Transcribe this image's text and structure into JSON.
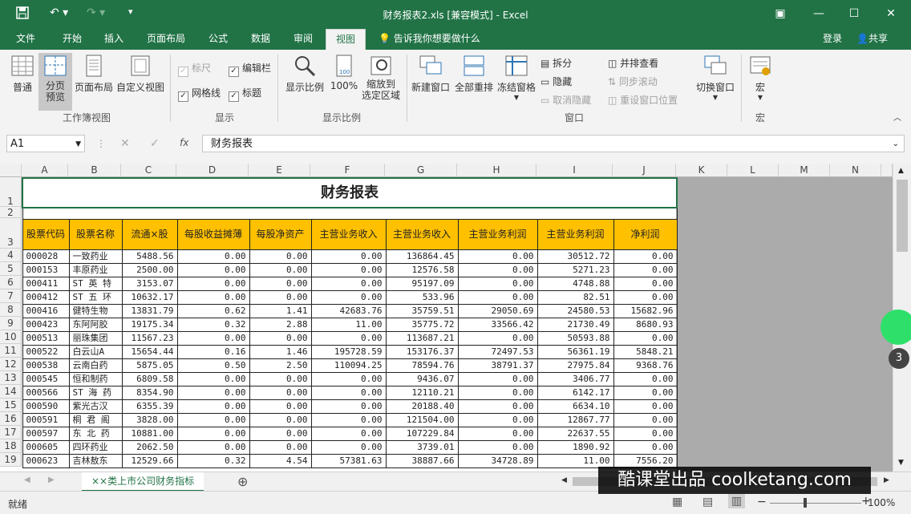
{
  "window": {
    "title": "财务报表2.xls  [兼容模式] - Excel",
    "account": "登录",
    "share": "共享",
    "tell_me": "告诉我你想要做什么"
  },
  "tabs": [
    "文件",
    "开始",
    "插入",
    "页面布局",
    "公式",
    "数据",
    "审阅",
    "视图"
  ],
  "ribbon": {
    "workbook_views": {
      "label": "工作簿视图",
      "normal": "普通",
      "page_break": "分页\n预览",
      "page_layout": "页面布局",
      "custom_views": "自定义视图"
    },
    "show": {
      "label": "显示",
      "ruler": "标尺",
      "gridlines": "网格线",
      "formula_bar": "编辑栏",
      "headings": "标题"
    },
    "zoom": {
      "label": "显示比例",
      "zoom": "显示比例",
      "hundred": "100%",
      "zoom_sel_1": "缩放到",
      "zoom_sel_2": "选定区域"
    },
    "window": {
      "label": "窗口",
      "new_window": "新建窗口",
      "arrange_all": "全部重排",
      "freeze": "冻结窗格",
      "split": "拆分",
      "hide": "隐藏",
      "unhide": "取消隐藏",
      "side_by_side": "并排查看",
      "sync_scroll": "同步滚动",
      "reset_pos": "重设窗口位置",
      "switch": "切换窗口"
    },
    "macros": {
      "label": "宏",
      "macros": "宏"
    }
  },
  "formula_bar": {
    "name_box": "A1",
    "content": "财务报表"
  },
  "columns": [
    "A",
    "B",
    "C",
    "D",
    "E",
    "F",
    "G",
    "H",
    "I",
    "J",
    "K",
    "L",
    "M",
    "N"
  ],
  "sheet": {
    "title": "财务报表",
    "headers": [
      "股票代码",
      "股票名称",
      "流通×股",
      "每股收益摊薄",
      "每股净资产",
      "主营业务收入",
      "主营业务收入",
      "主营业务利润",
      "主营业务利润",
      "净利润"
    ],
    "rows": [
      [
        "000028",
        "一致药业",
        "5488.56",
        "0.00",
        "0.00",
        "0.00",
        "136864.45",
        "0.00",
        "30512.72",
        "0.00"
      ],
      [
        "000153",
        "丰原药业",
        "2500.00",
        "0.00",
        "0.00",
        "0.00",
        "12576.58",
        "0.00",
        "5271.23",
        "0.00"
      ],
      [
        "000411",
        "ST 英 特",
        "3153.07",
        "0.00",
        "0.00",
        "0.00",
        "95197.09",
        "0.00",
        "4748.88",
        "0.00"
      ],
      [
        "000412",
        "ST 五 环",
        "10632.17",
        "0.00",
        "0.00",
        "0.00",
        "533.96",
        "0.00",
        "82.51",
        "0.00"
      ],
      [
        "000416",
        "健特生物",
        "13831.79",
        "0.62",
        "1.41",
        "42683.76",
        "35759.51",
        "29050.69",
        "24580.53",
        "15682.96"
      ],
      [
        "000423",
        "东阿阿胶",
        "19175.34",
        "0.32",
        "2.88",
        "11.00",
        "35775.72",
        "33566.42",
        "21730.49",
        "8680.93"
      ],
      [
        "000513",
        "丽珠集团",
        "11567.23",
        "0.00",
        "0.00",
        "0.00",
        "113687.21",
        "0.00",
        "50593.88",
        "0.00"
      ],
      [
        "000522",
        "白云山A",
        "15654.44",
        "0.16",
        "1.46",
        "195728.59",
        "153176.37",
        "72497.53",
        "56361.19",
        "5848.21"
      ],
      [
        "000538",
        "云南白药",
        "5875.05",
        "0.50",
        "2.50",
        "110094.25",
        "78594.76",
        "38791.37",
        "27975.84",
        "9368.76"
      ],
      [
        "000545",
        "恒和制药",
        "6809.58",
        "0.00",
        "0.00",
        "0.00",
        "9436.07",
        "0.00",
        "3406.77",
        "0.00"
      ],
      [
        "000566",
        "ST 海 药",
        "8354.90",
        "0.00",
        "0.00",
        "0.00",
        "12110.21",
        "0.00",
        "6142.17",
        "0.00"
      ],
      [
        "000590",
        "紫光古汉",
        "6355.39",
        "0.00",
        "0.00",
        "0.00",
        "20188.40",
        "0.00",
        "6634.10",
        "0.00"
      ],
      [
        "000591",
        "桐 君 阁",
        "3828.00",
        "0.00",
        "0.00",
        "0.00",
        "121504.00",
        "0.00",
        "12867.77",
        "0.00"
      ],
      [
        "000597",
        "东 北 药",
        "10881.00",
        "0.00",
        "0.00",
        "0.00",
        "107229.84",
        "0.00",
        "22637.55",
        "0.00"
      ],
      [
        "000605",
        "四环药业",
        "2062.50",
        "0.00",
        "0.00",
        "0.00",
        "3739.01",
        "0.00",
        "1890.92",
        "0.00"
      ],
      [
        "000623",
        "吉林敖东",
        "12529.66",
        "0.32",
        "4.54",
        "57381.63",
        "38887.66",
        "34728.89",
        "11.00",
        "7556.20"
      ]
    ]
  },
  "sheet_tab": "××类上市公司财务指标",
  "status": {
    "ready": "就绪",
    "zoom": "100%"
  },
  "watermark": "酷课堂出品 coolketang.com",
  "badge": "3"
}
